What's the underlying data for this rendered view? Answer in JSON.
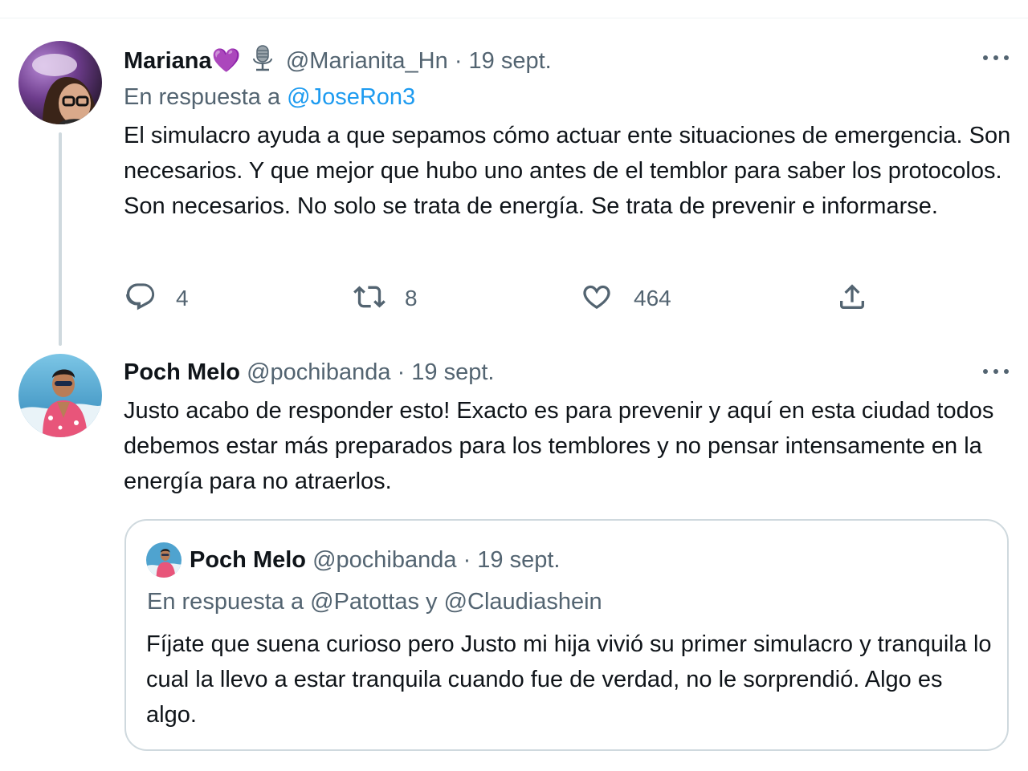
{
  "tweets": [
    {
      "name": "Mariana",
      "name_emoji": "💜",
      "handle": "@Marianita_Hn",
      "date": "· 19 sept.",
      "reply_prefix": "En respuesta a",
      "reply_to": "@JoseRon3",
      "text": "El simulacro ayuda a que sepamos cómo actuar ente situaciones de emergencia. Son necesarios. Y que mejor que hubo uno antes de el temblor para saber los protocolos. Son necesarios. No solo se trata de energía. Se trata de prevenir e informarse.",
      "actions": {
        "replies": "4",
        "retweets": "8",
        "likes": "464"
      },
      "icons": {
        "badge": "microphone-icon",
        "more": "more-icon"
      }
    },
    {
      "name": "Poch Melo",
      "handle": "@pochibanda",
      "date": "· 19 sept.",
      "text": "Justo acabo de responder esto! Exacto es para prevenir y aquí en esta ciudad todos debemos estar más preparados para los temblores y no pensar intensamente en la energía para no atraerlos.",
      "quote": {
        "name": "Poch Melo",
        "handle": "@pochibanda",
        "date": "· 19 sept.",
        "reply_line": "En respuesta a @Patottas y @Claudiashein",
        "text": "Fíjate que suena curioso pero Justo mi hija vivió su primer simulacro y tranquila lo cual la llevo a estar tranquila cuando fue de verdad, no le sorprendió. Algo es algo."
      }
    }
  ],
  "colors": {
    "text": "#0f1419",
    "secondary": "#536471",
    "link": "#1d9bf0",
    "border": "#cfd9de"
  }
}
